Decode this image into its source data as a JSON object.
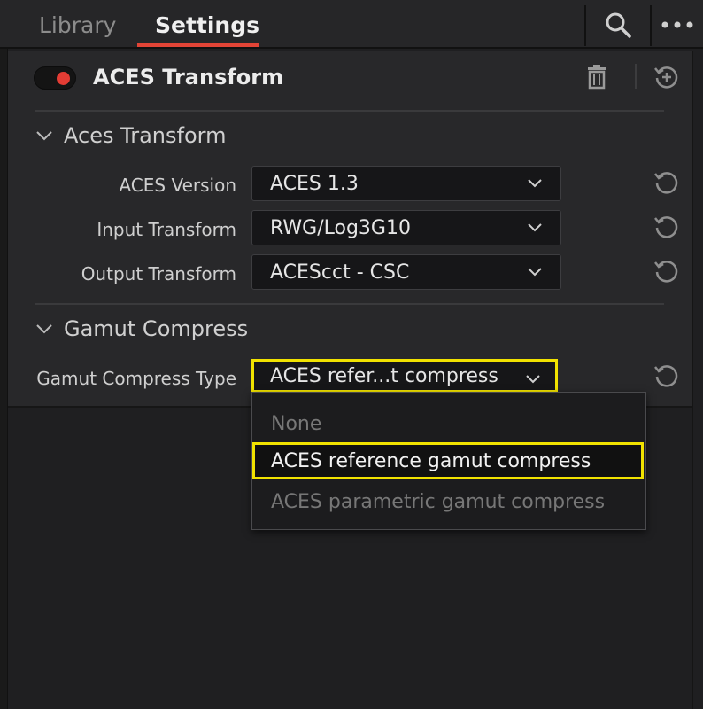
{
  "tabs": [
    {
      "label": "Library",
      "active": false
    },
    {
      "label": "Settings",
      "active": true
    }
  ],
  "toolbar": {
    "search_icon": "search-icon",
    "more_icon": "more-icon"
  },
  "node": {
    "title": "ACES Transform",
    "enabled": true,
    "toggle_color": "#e33c34"
  },
  "sections": {
    "aces": {
      "title": "Aces Transform",
      "rows": [
        {
          "label": "ACES Version",
          "value": "ACES 1.3"
        },
        {
          "label": "Input Transform",
          "value": "RWG/Log3G10"
        },
        {
          "label": "Output Transform",
          "value": "ACEScct - CSC"
        }
      ]
    },
    "gamut": {
      "title": "Gamut Compress",
      "label": "Gamut Compress Type",
      "value": "ACES refer...t compress",
      "options": [
        {
          "label": "None",
          "state": "disabled"
        },
        {
          "label": "ACES reference gamut compress",
          "state": "selected"
        },
        {
          "label": "ACES parametric gamut compress",
          "state": "disabled"
        }
      ]
    }
  },
  "highlight_color": "#f1e200"
}
